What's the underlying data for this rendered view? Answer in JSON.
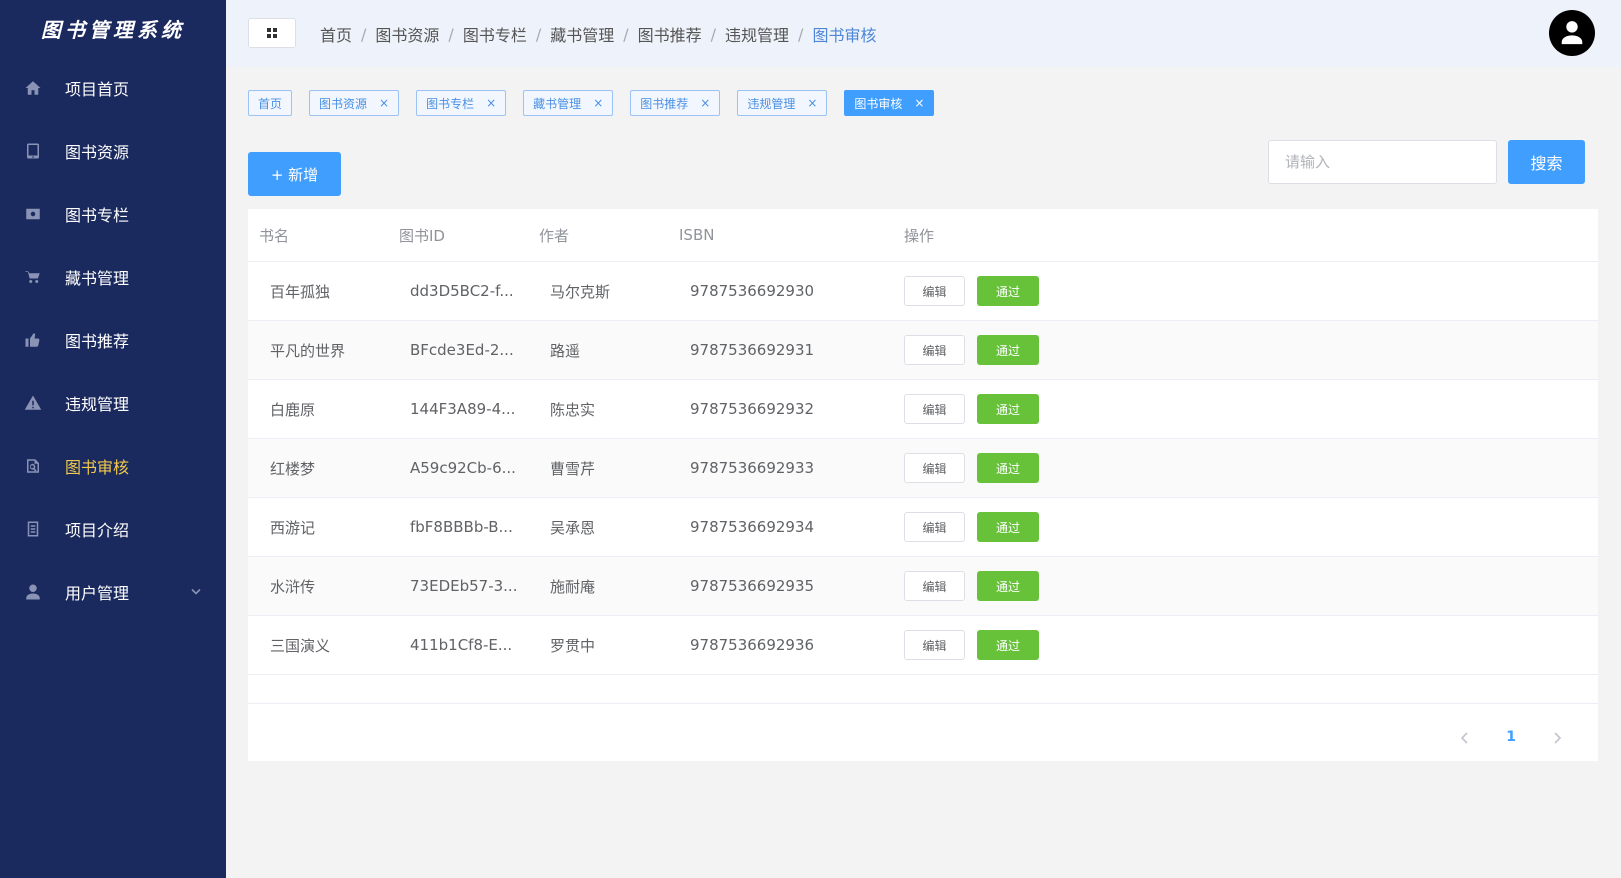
{
  "sidebar": {
    "brand": "图书管理系统",
    "items": [
      {
        "label": "项目首页",
        "icon": "home-icon"
      },
      {
        "label": "图书资源",
        "icon": "tablet-icon"
      },
      {
        "label": "图书专栏",
        "icon": "picture-icon"
      },
      {
        "label": "藏书管理",
        "icon": "cart-icon"
      },
      {
        "label": "图书推荐",
        "icon": "thumbs-up-icon"
      },
      {
        "label": "违规管理",
        "icon": "warning-icon"
      },
      {
        "label": "图书审核",
        "icon": "search-review-icon",
        "active": true
      },
      {
        "label": "项目介绍",
        "icon": "document-icon"
      },
      {
        "label": "用户管理",
        "icon": "user-icon",
        "expandable": true
      }
    ]
  },
  "header": {
    "breadcrumb": [
      "首页",
      "图书资源",
      "图书专栏",
      "藏书管理",
      "图书推荐",
      "违规管理",
      "图书审核"
    ],
    "separator": "/"
  },
  "tags": [
    {
      "label": "首页",
      "closable": false
    },
    {
      "label": "图书资源",
      "closable": true
    },
    {
      "label": "图书专栏",
      "closable": true
    },
    {
      "label": "藏书管理",
      "closable": true
    },
    {
      "label": "图书推荐",
      "closable": true
    },
    {
      "label": "违规管理",
      "closable": true
    },
    {
      "label": "图书审核",
      "closable": true,
      "active": true
    }
  ],
  "tag_close_glyph": "×",
  "toolbar": {
    "add_label": "+ 新增",
    "search_placeholder": "请输入",
    "search_label": "搜索"
  },
  "table": {
    "headers": [
      "书名",
      "图书ID",
      "作者",
      "ISBN",
      "操作"
    ],
    "rows": [
      {
        "name": "百年孤独",
        "id": "dd3D5BC2-f...",
        "author": "马尔克斯",
        "isbn": "9787536692930"
      },
      {
        "name": "平凡的世界",
        "id": "BFcde3Ed-2...",
        "author": "路遥",
        "isbn": "9787536692931"
      },
      {
        "name": "白鹿原",
        "id": "144F3A89-4...",
        "author": "陈忠实",
        "isbn": "9787536692932"
      },
      {
        "name": "红楼梦",
        "id": "A59c92Cb-6...",
        "author": "曹雪芹",
        "isbn": "9787536692933"
      },
      {
        "name": "西游记",
        "id": "fbF8BBBb-B...",
        "author": "吴承恩",
        "isbn": "9787536692934"
      },
      {
        "name": "水浒传",
        "id": "73EDEb57-3...",
        "author": "施耐庵",
        "isbn": "9787536692935"
      },
      {
        "name": "三国演义",
        "id": "411b1Cf8-E...",
        "author": "罗贯中",
        "isbn": "9787536692936"
      }
    ],
    "edit_label": "编辑",
    "pass_label": "通过"
  },
  "pagination": {
    "current": "1"
  },
  "colors": {
    "sidebar_bg": "#1b2a5e",
    "primary": "#409eff",
    "success": "#67c23a",
    "active_menu": "#f2c94c"
  }
}
